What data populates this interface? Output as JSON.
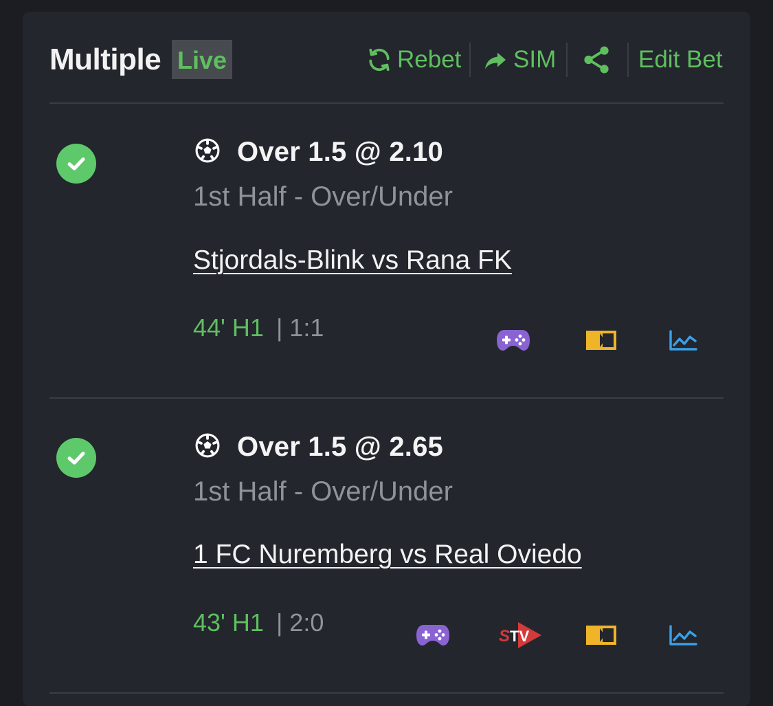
{
  "header": {
    "title": "Multiple",
    "live_badge": "Live",
    "actions": {
      "rebet": "Rebet",
      "sim": "SIM",
      "edit_bet": "Edit Bet"
    }
  },
  "legs": [
    {
      "selection": "Over 1.5 @ 2.10",
      "market": "1st Half - Over/Under",
      "event": "Stjordals-Blink vs Rana FK",
      "clock": "44' H1",
      "score": "| 1:1",
      "icons": [
        "gamepad-icon",
        "score-panel-icon",
        "stats-chart-icon"
      ]
    },
    {
      "selection": "Over 1.5 @ 2.65",
      "market": "1st Half - Over/Under",
      "event": "1 FC Nuremberg vs Real Oviedo",
      "clock": "43' H1",
      "score": "| 2:0",
      "icons": [
        "gamepad-icon",
        "stv-icon",
        "score-panel-icon",
        "stats-chart-icon"
      ]
    }
  ],
  "colors": {
    "background": "#1b1d22",
    "card": "#23262d",
    "accent_green": "#5fbf5f",
    "check_green": "#5ec96b",
    "muted_text": "#8f9299",
    "gamepad_purple": "#8a63d2",
    "stv_red": "#d33a3a",
    "panel_yellow": "#f0b429",
    "chart_blue": "#3aa0ea"
  }
}
